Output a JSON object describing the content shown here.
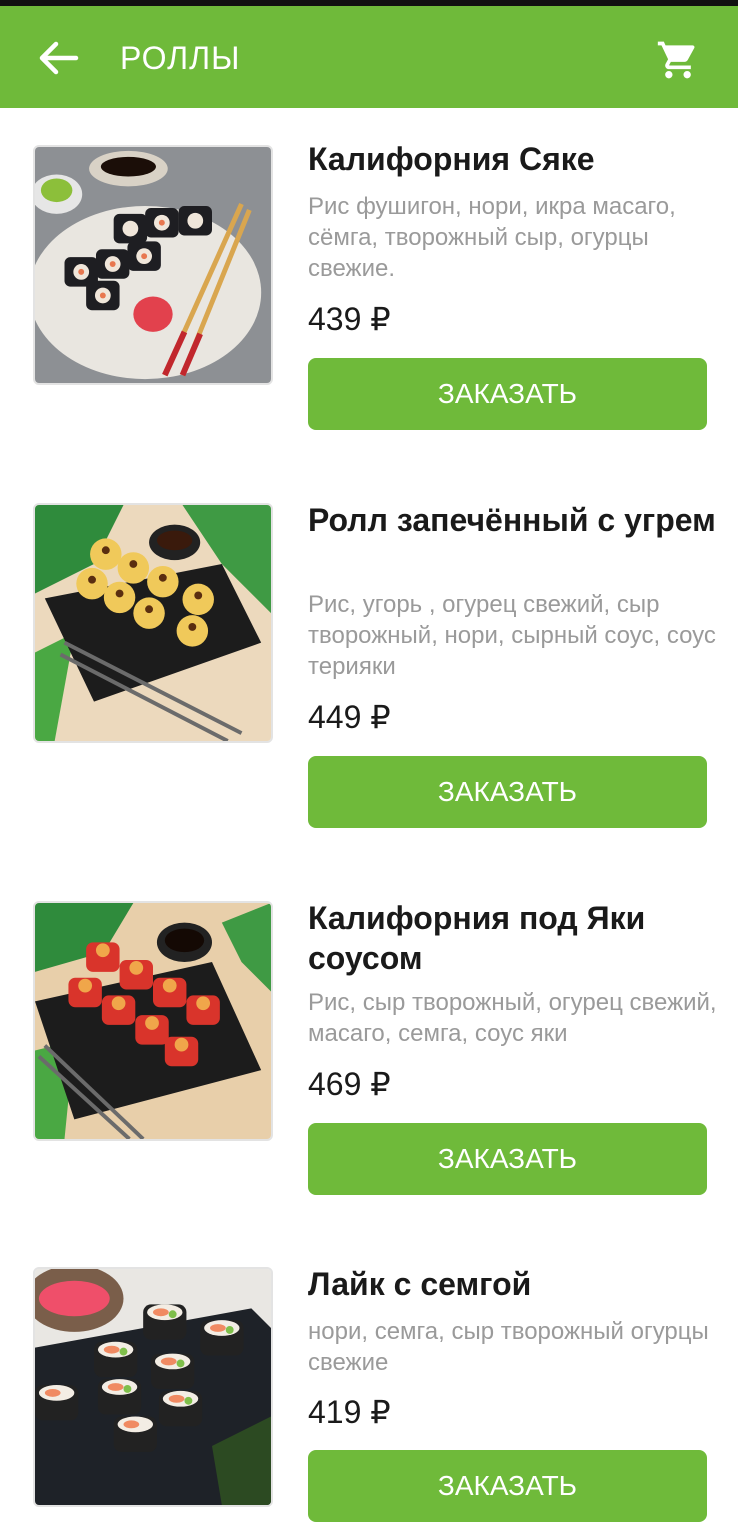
{
  "header": {
    "title": "РОЛЛЫ",
    "back_icon": "arrow-back-icon",
    "cart_icon": "shopping-cart-icon"
  },
  "colors": {
    "accent": "#6fba3a",
    "title_text": "#1a1a1a",
    "desc_text": "#9a9a9a"
  },
  "products": [
    {
      "title": "Калифорния Сяке",
      "description": "Рис фушигон, нори, икра масаго, сёмга, творожный сыр, огурцы свежие.",
      "price": "439 ₽",
      "button": "ЗАКАЗАТЬ"
    },
    {
      "title": "Ролл запечённый с угрем",
      "description": "Рис, угорь , огурец свежий, сыр творожный, нори, сырный соус, соус терияки",
      "price": "449 ₽",
      "button": "ЗАКАЗАТЬ"
    },
    {
      "title": "Калифорния под Яки соусом",
      "description": "Рис, сыр творожный, огурец свежий, масаго, семга, соус яки",
      "price": "469 ₽",
      "button": "ЗАКАЗАТЬ"
    },
    {
      "title": "Лайк с семгой",
      "description": "нори, семга, сыр творожный огурцы свежие",
      "price": "419 ₽",
      "button": "ЗАКАЗАТЬ"
    }
  ]
}
